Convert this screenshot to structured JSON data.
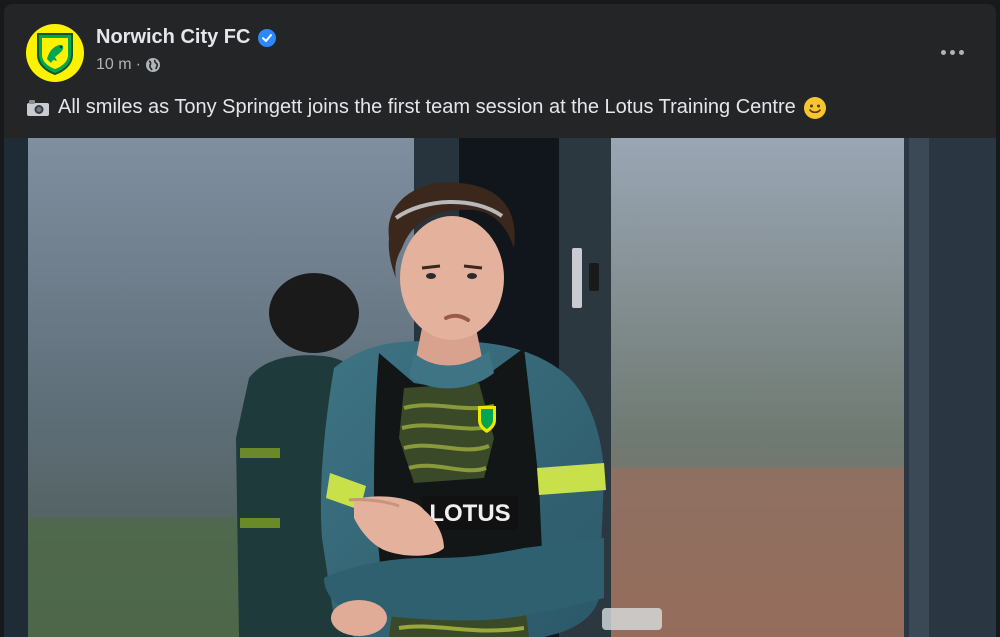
{
  "post": {
    "page_name": "Norwich City FC",
    "timestamp": "10 m",
    "separator": "·",
    "caption_text": "All smiles as Tony Springett joins the first team session at the Lotus Training Centre",
    "bib_sponsor": "LOTUS"
  },
  "icons": {
    "verified": "verified-badge-icon",
    "audience": "globe-icon",
    "more": "more-options-icon",
    "camera": "camera-emoji-icon",
    "smile": "smile-emoji-icon"
  },
  "colors": {
    "card_bg": "#242526",
    "text_primary": "#e4e6eb",
    "text_secondary": "#b0b3b8",
    "verified_blue": "#2d88ff",
    "club_yellow": "#fff200",
    "club_green": "#00a650"
  }
}
